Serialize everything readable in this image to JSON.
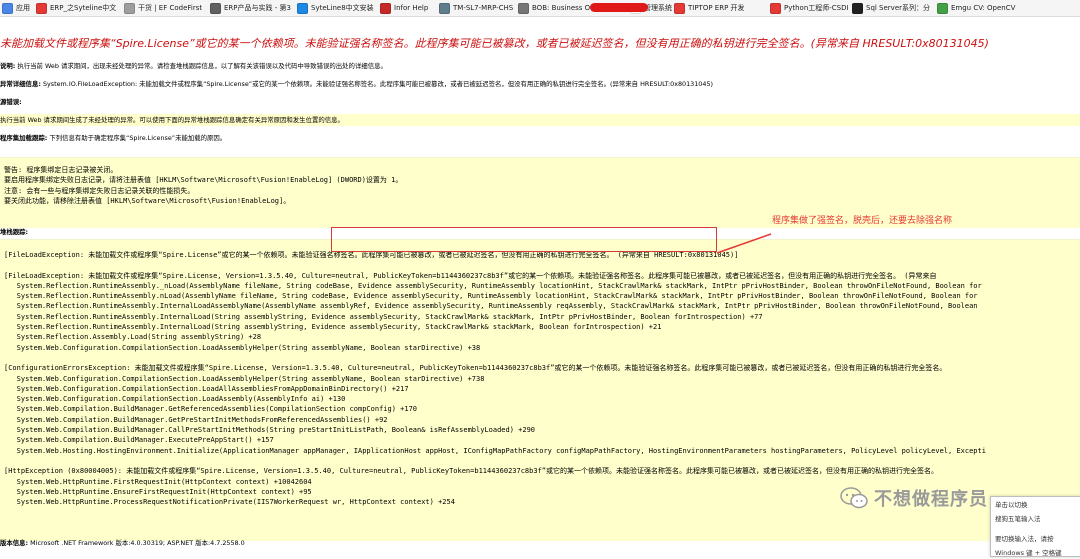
{
  "bookmarks": [
    {
      "label": "应用",
      "color": "#4a86e8"
    },
    {
      "label": "ERP_之Syteline中文",
      "color": "#e53935"
    },
    {
      "label": "干货 | EF CodeFirst",
      "color": "#9e9e9e"
    },
    {
      "label": "ERP产品与实践 - 第3",
      "color": "#616161"
    },
    {
      "label": "SyteLine8中文安装",
      "color": "#1e88e5"
    },
    {
      "label": "Infor Help",
      "color": "#c62828"
    },
    {
      "label": "TM-SL7-MRP-CHS",
      "color": "#607d8b"
    },
    {
      "label": "BOB: Business Obj",
      "color": "#757575"
    },
    {
      "label": "管理系统",
      "color": "#ffffff"
    },
    {
      "label": "TIPTOP ERP 开发",
      "color": "#e53935"
    },
    {
      "label": "Python工程师-CSDI",
      "color": "#e53935"
    },
    {
      "label": "Sql Server系列：分",
      "color": "#212121"
    },
    {
      "label": "Emgu CV: OpenCV",
      "color": "#43a047"
    }
  ],
  "error": {
    "title": "未能加载文件或程序集“Spire.License”或它的某一个依赖项。未能验证强名称签名。此程序集可能已被篡改，或者已被延迟签名，但没有用正确的私钥进行完全签名。(异常来自 HRESULT:0x80131045)",
    "desc_label": "说明:",
    "desc_text": "执行当前 Web 请求期间，出现未经处理的异常。请检查堆栈跟踪信息，以了解有关该错误以及代码中导致错误的出处的详细信息。",
    "exc_label": "异常详细信息:",
    "exc_text": "System.IO.FileLoadException: 未能加载文件或程序集“Spire.License”或它的某一个依赖项。未能验证强名称签名。此程序集可能已被篡改，或者已被延迟签名，但没有用正确的私钥进行完全签名。(异常来自 HRESULT:0x80131045)",
    "src_label": "源错误:",
    "src_text": "执行当前 Web 请求期间生成了未经处理的异常。可以使用下面的异常堆栈跟踪信息确定有关异常原因和发生位置的信息。",
    "asm_label": "程序集加载跟踪:",
    "asm_text": "下列信息有助于确定程序集“Spire.License”未能加载的原因。",
    "log_text": "警告: 程序集绑定日志记录被关闭。\n要启用程序集绑定失败日志记录，请将注册表值 [HKLM\\Software\\Microsoft\\Fusion!EnableLog] (DWORD)设置为 1。\n注意: 会有一些与程序集绑定失败日志记录关联的性能损失。\n要关闭此功能，请移除注册表值 [HKLM\\Software\\Microsoft\\Fusion!EnableLog]。",
    "stack_label": "堆栈跟踪:",
    "stack_text": "[FileLoadException: 未能加载文件或程序集“Spire.License”或它的某一个依赖项。未能验证强名称签名。此程序集可能已被篡改，或者已被延迟签名，但没有用正确的私钥进行完全签名。 (异常来自 HRESULT:0x80131045)]\n\n[FileLoadException: 未能加载文件或程序集“Spire.License, Version=1.3.5.40, Culture=neutral, PublicKeyToken=b1144360237c8b3f”或它的某一个依赖项。未能验证强名称签名。此程序集可能已被篡改，或者已被延迟签名，但没有用正确的私钥进行完全签名。 (异常来自\n   System.Reflection.RuntimeAssembly._nLoad(AssemblyName fileName, String codeBase, Evidence assemblySecurity, RuntimeAssembly locationHint, StackCrawlMark& stackMark, IntPtr pPrivHostBinder, Boolean throwOnFileNotFound, Boolean for\n   System.Reflection.RuntimeAssembly.nLoad(AssemblyName fileName, String codeBase, Evidence assemblySecurity, RuntimeAssembly locationHint, StackCrawlMark& stackMark, IntPtr pPrivHostBinder, Boolean throwOnFileNotFound, Boolean for\n   System.Reflection.RuntimeAssembly.InternalLoadAssemblyName(AssemblyName assemblyRef, Evidence assemblySecurity, RuntimeAssembly reqAssembly, StackCrawlMark& stackMark, IntPtr pPrivHostBinder, Boolean throwOnFileNotFound, Boolean\n   System.Reflection.RuntimeAssembly.InternalLoad(String assemblyString, Evidence assemblySecurity, StackCrawlMark& stackMark, IntPtr pPrivHostBinder, Boolean forIntrospection) +77\n   System.Reflection.RuntimeAssembly.InternalLoad(String assemblyString, Evidence assemblySecurity, StackCrawlMark& stackMark, Boolean forIntrospection) +21\n   System.Reflection.Assembly.Load(String assemblyString) +28\n   System.Web.Configuration.CompilationSection.LoadAssemblyHelper(String assemblyName, Boolean starDirective) +38\n\n[ConfigurationErrorsException: 未能加载文件或程序集“Spire.License, Version=1.3.5.40, Culture=neutral, PublicKeyToken=b1144360237c8b3f”或它的某一个依赖项。未能验证强名称签名。此程序集可能已被篡改，或者已被延迟签名，但没有用正确的私钥进行完全签名。\n   System.Web.Configuration.CompilationSection.LoadAssemblyHelper(String assemblyName, Boolean starDirective) +738\n   System.Web.Configuration.CompilationSection.LoadAllAssembliesFromAppDomainBinDirectory() +217\n   System.Web.Configuration.CompilationSection.LoadAssembly(AssemblyInfo ai) +130\n   System.Web.Compilation.BuildManager.GetReferencedAssemblies(CompilationSection compConfig) +170\n   System.Web.Compilation.BuildManager.GetPreStartInitMethodsFromReferencedAssemblies() +92\n   System.Web.Compilation.BuildManager.CallPreStartInitMethods(String preStartInitListPath, Boolean& isRefAssemblyLoaded) +290\n   System.Web.Compilation.BuildManager.ExecutePreAppStart() +157\n   System.Web.Hosting.HostingEnvironment.Initialize(ApplicationManager appManager, IApplicationHost appHost, IConfigMapPathFactory configMapPathFactory, HostingEnvironmentParameters hostingParameters, PolicyLevel policyLevel, Excepti\n\n[HttpException (0x80004005): 未能加载文件或程序集“Spire.License, Version=1.3.5.40, Culture=neutral, PublicKeyToken=b1144360237c8b3f”或它的某一个依赖项。未能验证强名称签名。此程序集可能已被篡改，或者已被延迟签名，但没有用正确的私钥进行完全签名。\n   System.Web.HttpRuntime.FirstRequestInit(HttpContext context) +10042604\n   System.Web.HttpRuntime.EnsureFirstRequestInit(HttpContext context) +95\n   System.Web.HttpRuntime.ProcessRequestNotificationPrivate(IIS7WorkerRequest wr, HttpContext context) +254",
    "version_label": "版本信息:",
    "version_text": "Microsoft .NET Framework 版本:4.0.30319; ASP.NET 版本:4.7.2558.0"
  },
  "annotation": {
    "text": "程序集做了强签名，脱壳后，还要去除强名称",
    "color": "#e53935"
  },
  "watermark": {
    "text": "不想做程序员"
  },
  "ime_popup": {
    "line1": "单击以切换",
    "line2": "搜狗五笔输入法",
    "line3": "要切换输入法，请按",
    "line4": "Windows 键 + 空格键"
  }
}
